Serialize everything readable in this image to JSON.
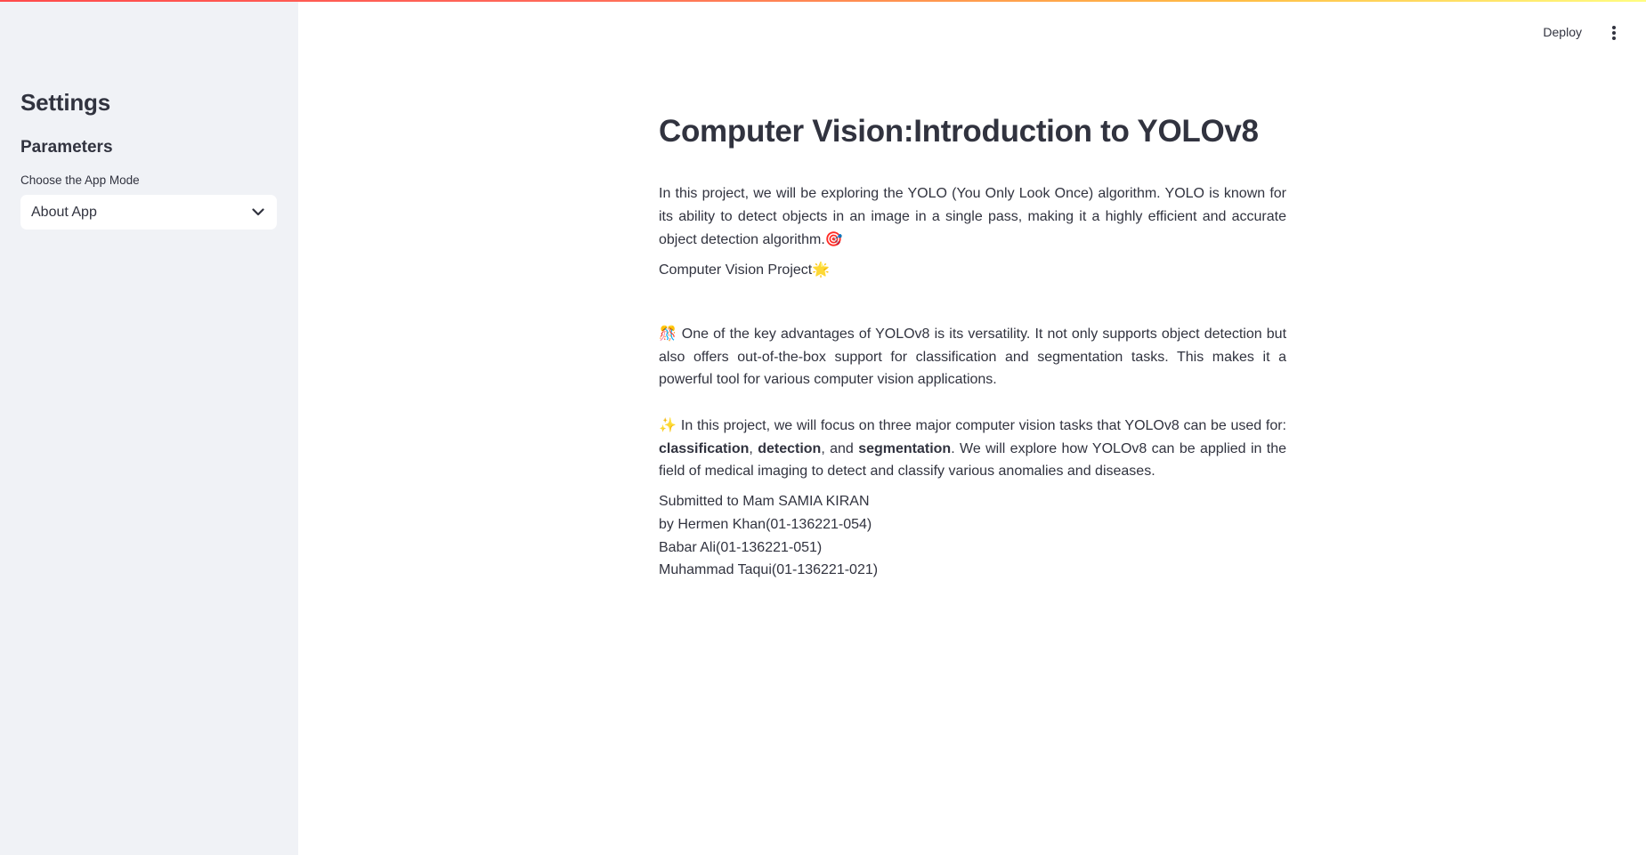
{
  "sidebar": {
    "title": "Settings",
    "subtitle": "Parameters",
    "mode_label": "Choose the App Mode",
    "mode_value": "About App"
  },
  "header": {
    "deploy_label": "Deploy",
    "menu_icon": "kebab-menu-icon"
  },
  "main": {
    "title": "Computer Vision:Introduction to YOLOv8",
    "intro": "In this project, we will be exploring the YOLO (You Only Look Once) algorithm. YOLO is known for its ability to detect objects in an image in a single pass, making it a highly efficient and accurate object detection algorithm.",
    "intro_emoji": "🎯",
    "project_label": "Computer Vision Project",
    "project_emoji": "🌟",
    "advantages_emoji": "🎊",
    "advantages": "One of the key advantages of YOLOv8 is its versatility. It not only supports object detection but also offers out-of-the-box support for classification and segmentation tasks. This makes it a powerful tool for various computer vision applications.",
    "focus_emoji": "✨",
    "focus_start": "In this project, we will focus on three major computer vision tasks that YOLOv8 can be used for: ",
    "task1": "classification",
    "sep1": ", ",
    "task2": "detection",
    "sep2": ", and ",
    "task3": "segmentation",
    "focus_end": ". We will explore how YOLOv8 can be applied in the field of medical imaging to detect and classify various anomalies and diseases.",
    "credits": [
      "Submitted to Mam SAMIA KIRAN",
      "by Hermen Khan(01-136221-054)",
      "Babar Ali(01-136221-051)",
      "Muhammad Taqui(01-136221-021)"
    ]
  }
}
